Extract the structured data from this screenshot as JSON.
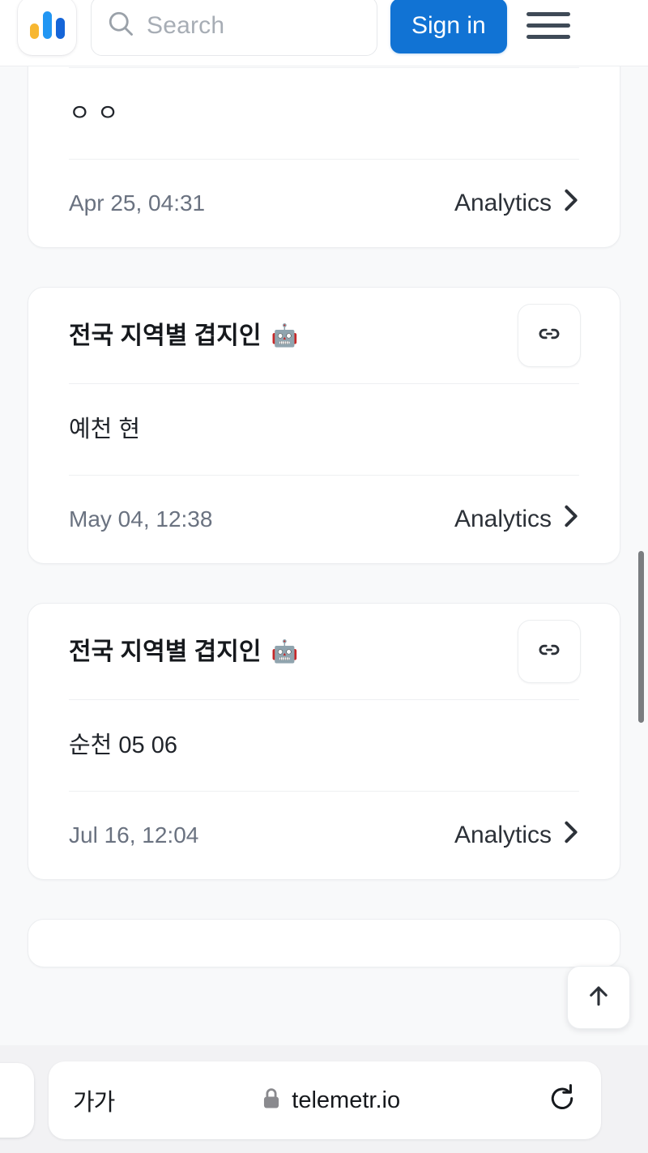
{
  "header": {
    "logo_name": "telemetr-logo",
    "logo_colors": [
      "#f7b731",
      "#2196f3",
      "#1565d8"
    ],
    "search_placeholder": "Search",
    "search_value": "",
    "signin_label": "Sign in",
    "menu_label": "Menu"
  },
  "accent_color": "#1173d4",
  "cards": [
    {
      "title": "",
      "has_robot": false,
      "body": "ㅇ ㅇ",
      "timestamp": "Apr 25, 04:31",
      "analytics_label": "Analytics",
      "clipped": true
    },
    {
      "title": "전국 지역별 겹지인",
      "has_robot": true,
      "robot_emoji": "🤖",
      "body": "예천 현",
      "timestamp": "May 04, 12:38",
      "analytics_label": "Analytics",
      "clipped": false
    },
    {
      "title": "전국 지역별 겹지인",
      "has_robot": true,
      "robot_emoji": "🤖",
      "body": "순천 05 06",
      "timestamp": "Jul 16, 12:04",
      "analytics_label": "Analytics",
      "clipped": false
    }
  ],
  "scroll_top": {
    "label": "Scroll to top"
  },
  "browser": {
    "text_size_label": "가가",
    "url": "telemetr.io",
    "secure": true,
    "reload_label": "Reload"
  }
}
